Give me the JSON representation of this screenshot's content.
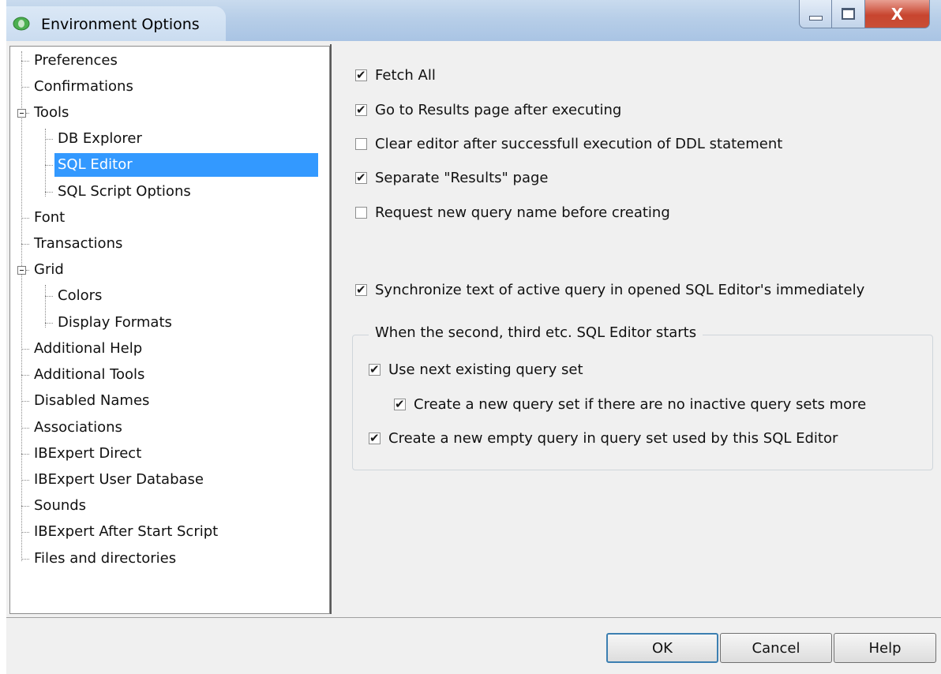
{
  "window": {
    "title": "Environment Options"
  },
  "title_controls": {
    "close_label": "X"
  },
  "tree": {
    "items": [
      {
        "label": "Preferences"
      },
      {
        "label": "Confirmations"
      },
      {
        "label": "Tools"
      },
      {
        "label": "DB Explorer"
      },
      {
        "label": "SQL Editor"
      },
      {
        "label": "SQL Script Options"
      },
      {
        "label": "Font"
      },
      {
        "label": "Transactions"
      },
      {
        "label": "Grid"
      },
      {
        "label": "Colors"
      },
      {
        "label": "Display Formats"
      },
      {
        "label": "Additional Help"
      },
      {
        "label": "Additional Tools"
      },
      {
        "label": "Disabled Names"
      },
      {
        "label": "Associations"
      },
      {
        "label": "IBExpert Direct"
      },
      {
        "label": "IBExpert User Database"
      },
      {
        "label": "Sounds"
      },
      {
        "label": "IBExpert After Start Script"
      },
      {
        "label": "Files and directories"
      }
    ],
    "selected": "SQL Editor"
  },
  "options": {
    "fetch_all": {
      "label": "Fetch All",
      "checked": true
    },
    "go_to_results": {
      "label": "Go to Results page after executing",
      "checked": true
    },
    "clear_editor": {
      "label": "Clear editor after successfull execution of DDL statement",
      "checked": false
    },
    "separate_results": {
      "label": "Separate \"Results\" page",
      "checked": true
    },
    "request_name": {
      "label": "Request new query name before creating",
      "checked": false
    },
    "synchronize": {
      "label": "Synchronize text of active query in opened SQL Editor's immediately",
      "checked": true
    }
  },
  "group": {
    "title": "When the second, third etc. SQL Editor starts",
    "use_next": {
      "label": "Use next existing query set",
      "checked": true
    },
    "create_new_set": {
      "label": "Create a new query set if there are no inactive query sets more",
      "checked": true
    },
    "create_empty_query": {
      "label": "Create a new empty query in query set used by this SQL Editor",
      "checked": true
    }
  },
  "buttons": {
    "ok": "OK",
    "cancel": "Cancel",
    "help": "Help"
  }
}
